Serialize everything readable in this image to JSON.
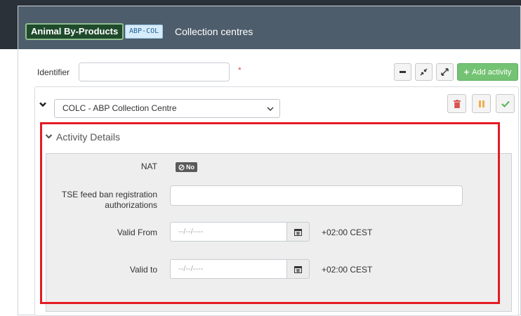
{
  "header": {
    "module_badge": "Animal By-Products",
    "code_badge": "ABP-COL",
    "title": "Collection centres"
  },
  "identifier": {
    "label": "Identifier",
    "value": "",
    "required_mark": "*"
  },
  "toolbar": {
    "add_activity_label": "Add activity"
  },
  "activity": {
    "selected": "COLC - ABP Collection Centre"
  },
  "details": {
    "section_title": "Activity Details",
    "nat_label": "NAT",
    "nat_value": "No",
    "tse_label_line1": "TSE feed ban registration",
    "tse_label_line2": "authorizations",
    "tse_value": "",
    "valid_from_label": "Valid From",
    "valid_from_placeholder": "--/--/----",
    "valid_from_tz": "+02:00 CEST",
    "valid_to_label": "Valid to",
    "valid_to_placeholder": "--/--/----",
    "valid_to_tz": "+02:00 CEST"
  },
  "colors": {
    "header_bg": "#4e5d6b",
    "badge_green": "#1f4a2b",
    "add_button": "#74c374",
    "delete_red": "#d9534f",
    "highlight_red": "#e41b23"
  }
}
